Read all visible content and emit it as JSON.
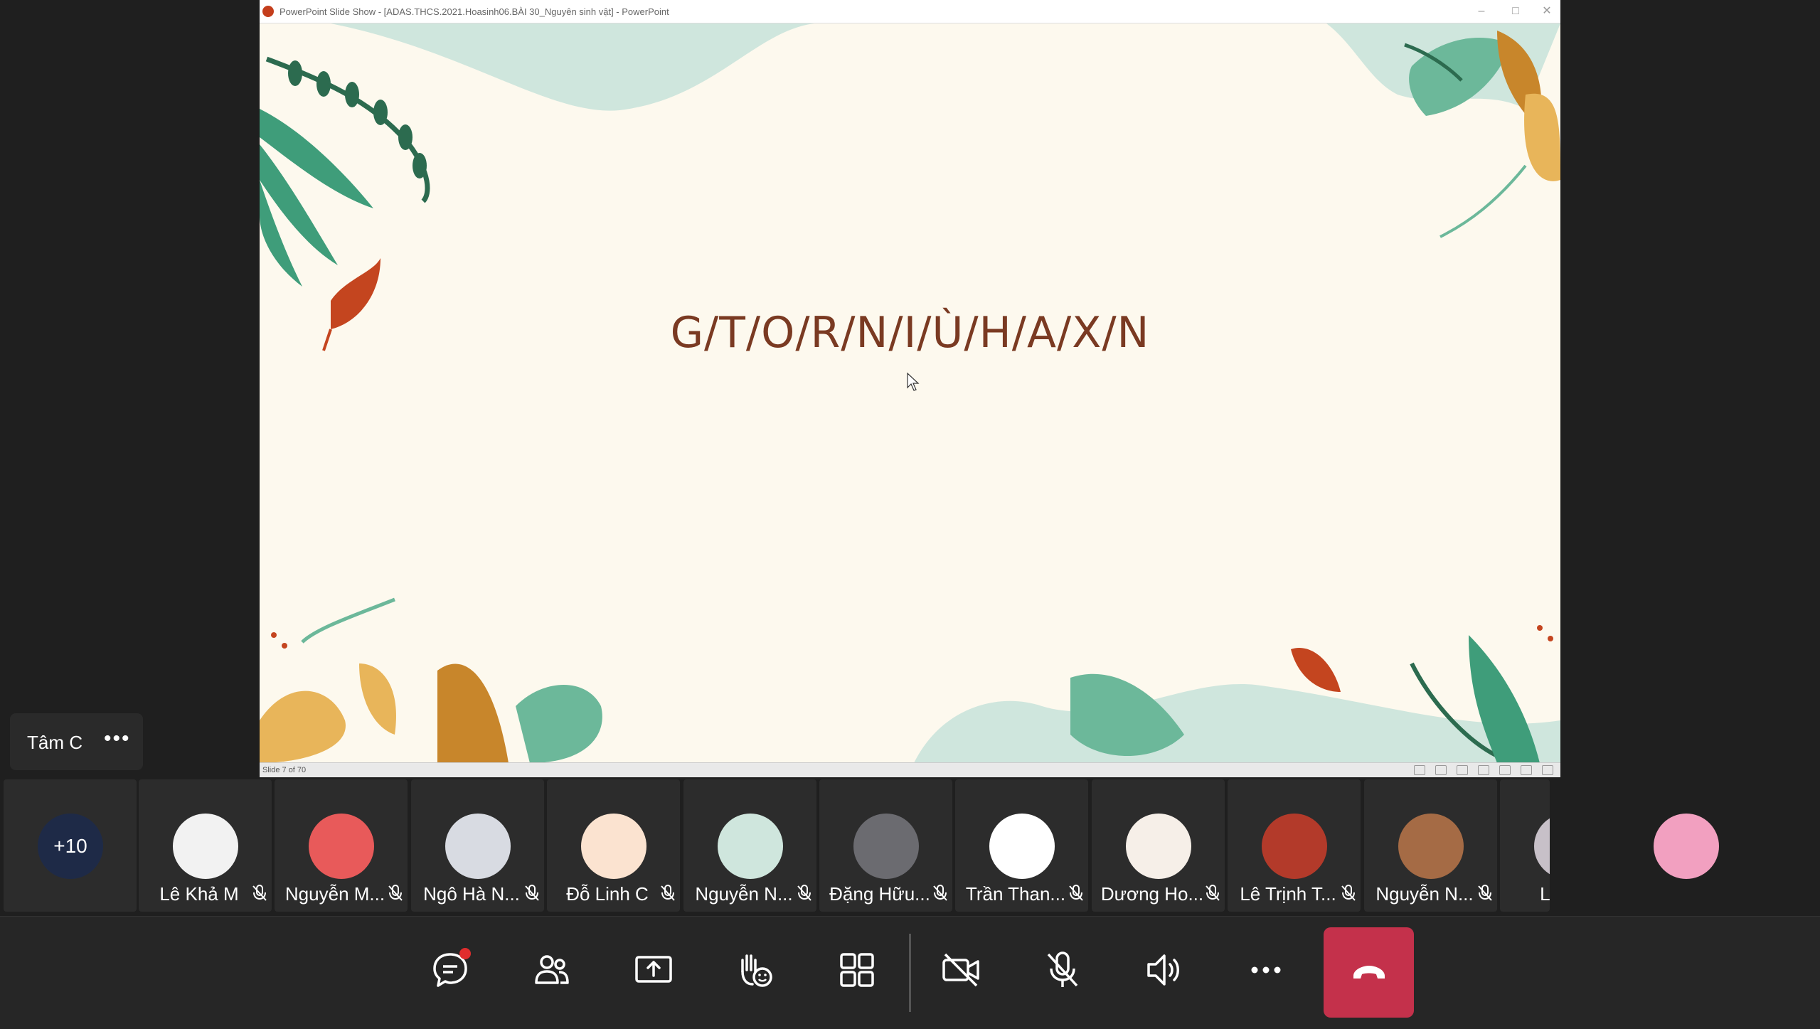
{
  "window": {
    "title": "PowerPoint Slide Show - [ADAS.THCS.2021.Hoasinh06.BÀI 30_Nguyên sinh vật] - PowerPoint",
    "minimize": "–",
    "maximize": "□",
    "close": "✕"
  },
  "slide": {
    "text": "G/T/O/R/N/I/Ù/H/A/X/N",
    "status": "Slide 7 of 70"
  },
  "speaker": {
    "name": "Tâm C",
    "more": "•••"
  },
  "participants": {
    "overflow_count": "+10",
    "items": [
      {
        "name": "Lê Khả M",
        "avatar_color": "#f2f2f2"
      },
      {
        "name": "Nguyễn M...",
        "avatar_color": "#e85a5a"
      },
      {
        "name": "Ngô Hà N...",
        "avatar_color": "#d8dbe2"
      },
      {
        "name": "Đỗ Linh C",
        "avatar_color": "#fbe3d0"
      },
      {
        "name": "Nguyễn N...",
        "avatar_color": "#cfe6dd"
      },
      {
        "name": "Đặng Hữu...",
        "avatar_color": "#6b6b70"
      },
      {
        "name": "Trần Than...",
        "avatar_color": "#ffffff"
      },
      {
        "name": "Dương Ho...",
        "avatar_color": "#f6efe8"
      },
      {
        "name": "Lê Trịnh T...",
        "avatar_color": "#b33a2a"
      },
      {
        "name": "Nguyễn N...",
        "avatar_color": "#a56b45"
      },
      {
        "name": "Lê M",
        "avatar_color": "#c7c0c8"
      }
    ]
  },
  "controls": {
    "chat": "chat-icon",
    "participants": "people-icon",
    "share": "share-screen-icon",
    "reactions": "raise-hand-icon",
    "layout": "grid-layout-icon",
    "camera": "camera-off-icon",
    "mic": "mic-off-icon",
    "speaker": "speaker-icon",
    "more": "more-icon",
    "leave": "hang-up-icon"
  },
  "colors": {
    "hangup": "#c4314b",
    "slide_text": "#7a3a22",
    "background": "#1f1f1f"
  }
}
